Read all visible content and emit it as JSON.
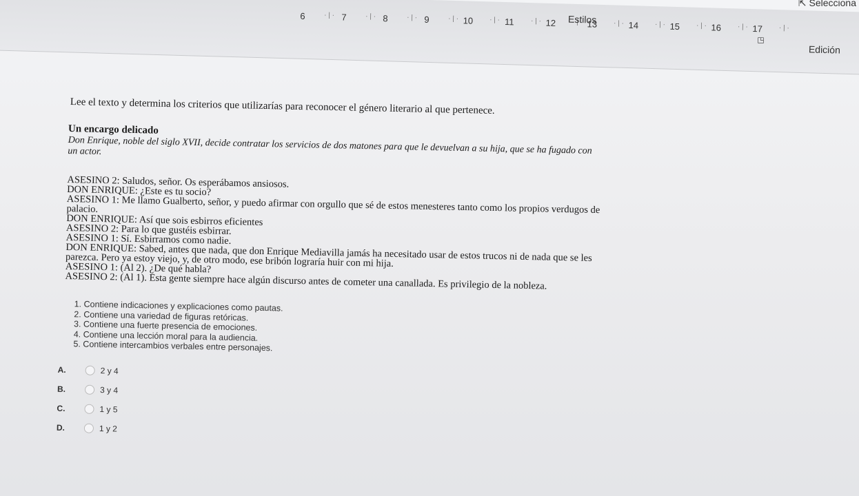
{
  "ribbon": {
    "ruler_numbers": [
      "6",
      "7",
      "8",
      "9",
      "10",
      "11",
      "12",
      "13",
      "14",
      "15",
      "16",
      "17"
    ],
    "estilos_label": "Estilos",
    "edicion_label": "Edición",
    "selecciona_label": "Selecciona"
  },
  "document": {
    "instruction": "Lee el texto y determina los criterios que utilizarías para reconocer el género literario al que pertenece.",
    "title": "Un encargo delicado",
    "intro_line1": "Don Enrique, noble del siglo XVII, decide contratar los servicios de dos matones para que le devuelvan a su hija, que se ha fugado con",
    "intro_line2": "un actor.",
    "dialog": [
      "ASESINO 2: Saludos, señor. Os esperábamos ansiosos.",
      "DON ENRIQUE: ¿Este es tu socio?",
      "ASESINO 1: Me llamo Gualberto, señor, y puedo afirmar con orgullo que sé de estos menesteres tanto como los propios verdugos de",
      "palacio.",
      "DON ENRIQUE: Así que sois esbirros eficientes",
      "ASESINO 2: Para lo que gustéis esbirrar.",
      "ASESINO 1: Sí. Esbirramos como nadie.",
      "DON ENRIQUE: Sabed, antes que nada, que don Enrique Mediavilla jamás ha necesitado usar de estos trucos ni de nada que se les",
      "parezca. Pero ya estoy viejo, y, de otro modo, ese bribón lograría huir con mi hija.",
      "ASESINO 1: (Al 2). ¿De qué habla?",
      "ASESINO 2: (Al 1). Esta gente siempre hace algún discurso antes de cometer una canallada. Es privilegio de la nobleza."
    ],
    "criteria": [
      "1. Contiene indicaciones y explicaciones como pautas.",
      "2. Contiene una variedad de figuras retóricas.",
      "3. Contiene una fuerte presencia de emociones.",
      "4. Contiene una lección moral para la audiencia.",
      "5. Contiene intercambios verbales entre personajes."
    ],
    "options": [
      {
        "letter": "A.",
        "text": "2 y 4"
      },
      {
        "letter": "B.",
        "text": "3 y 4"
      },
      {
        "letter": "C.",
        "text": "1 y 5"
      },
      {
        "letter": "D.",
        "text": "1 y 2"
      }
    ]
  }
}
